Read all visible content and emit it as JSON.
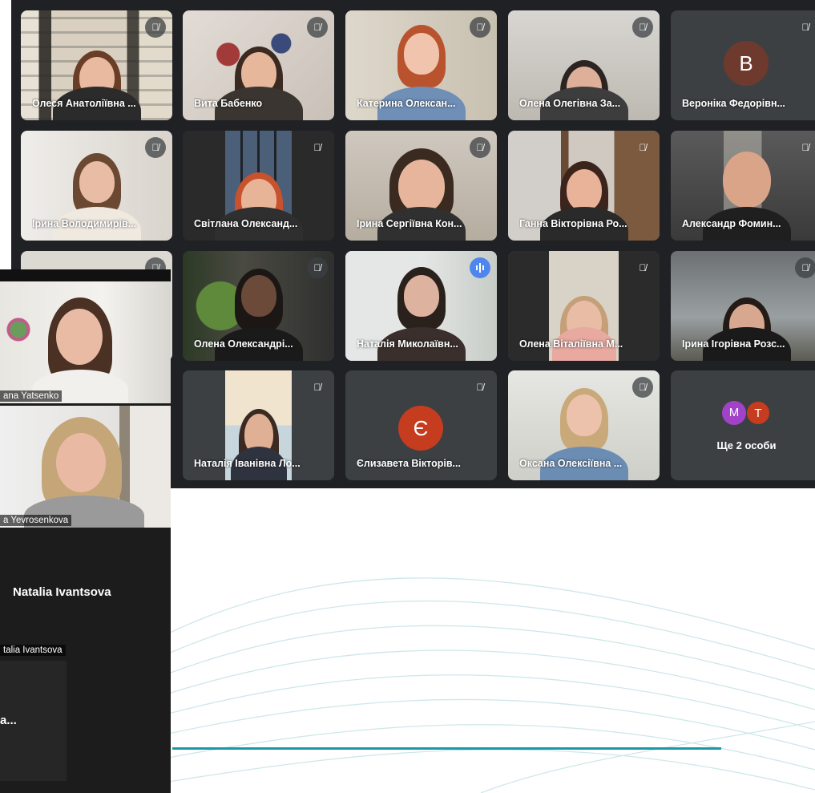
{
  "participants": [
    {
      "name": "Олеся Анатоліївна ...",
      "mic": "muted"
    },
    {
      "name": "Вита Бабенко",
      "mic": "muted"
    },
    {
      "name": "Катерина Олексан...",
      "mic": "muted"
    },
    {
      "name": "Олена Олегівна За...",
      "mic": "muted"
    },
    {
      "name": "Вероніка Федорівн...",
      "mic": "muted",
      "avatar_letter": "B",
      "avatar_color": "#6d3a2d"
    },
    {
      "name": "Ірина Володимирів...",
      "mic": "muted"
    },
    {
      "name": "Світлана Олександ...",
      "mic": "muted"
    },
    {
      "name": "Ірина Сергіївна Кон...",
      "mic": "muted"
    },
    {
      "name": "Ганна Вікторівна Ро...",
      "mic": "muted"
    },
    {
      "name": "Александр Фомин...",
      "mic": "muted"
    },
    {
      "name": "Олена Олександрі...",
      "mic": "muted"
    },
    {
      "name": "Наталія Миколаївн...",
      "mic": "speaking"
    },
    {
      "name": "Олена Віталіївна М...",
      "mic": "muted"
    },
    {
      "name": "Ірина Ігорівна Розс...",
      "mic": "muted"
    },
    {
      "name": "Наталія Іванівна Ло...",
      "mic": "muted"
    },
    {
      "name": "Єлизавета Вікторів...",
      "mic": "muted",
      "avatar_letter": "Є",
      "avatar_color": "#c53c1e"
    },
    {
      "name": "Оксана Олексіївна ...",
      "mic": "muted"
    },
    {
      "name": "Ще 2 особи",
      "more_letters": [
        "M",
        "T"
      ],
      "more_colors": [
        "#a142c9",
        "#c53c1e"
      ]
    }
  ],
  "side_panel": {
    "tile1_label": "ana Yatsenko",
    "tile2_label": "a Yevrosenkova",
    "tile3_big_name": "Natalia Ivantsova",
    "tile3_label": "talia Ivantsova",
    "tile4_partial": "a..."
  },
  "colors": {
    "accent_line": "#1b98a5",
    "grid_bg": "#202124",
    "speaking": "#4f86ee"
  }
}
